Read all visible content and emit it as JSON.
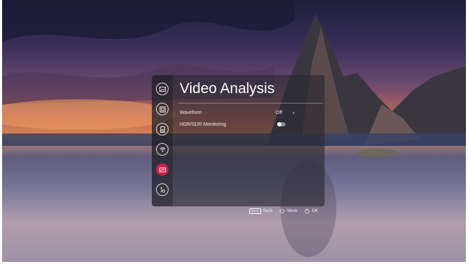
{
  "menu": {
    "title": "Video Analysis",
    "rail": [
      {
        "icon": "picture-icon"
      },
      {
        "icon": "screen-icon"
      },
      {
        "icon": "sound-icon"
      },
      {
        "icon": "connection-icon"
      },
      {
        "icon": "video-analysis-icon",
        "active": true
      },
      {
        "icon": "settings-icon"
      }
    ],
    "rows": [
      {
        "label": "Waveform",
        "value": "Off"
      },
      {
        "label": "HDR/SDR Monitoring",
        "toggle": false
      }
    ]
  },
  "hints": {
    "back_key": "BACK",
    "back": "Back",
    "move": "Move",
    "ok": "OK"
  },
  "colors": {
    "accent": "#c8234d",
    "panel": "#28282f"
  }
}
